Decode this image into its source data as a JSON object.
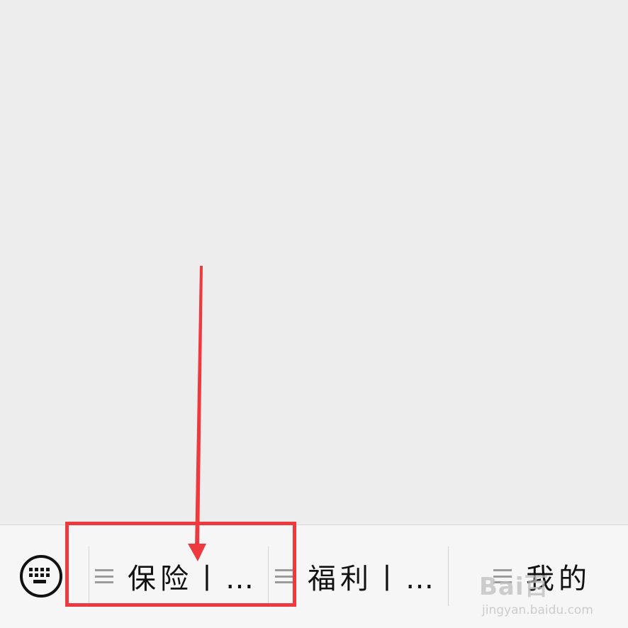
{
  "bottom_menu": {
    "items": [
      {
        "label": "保险丨…",
        "icon": "menu-lines-icon"
      },
      {
        "label": "福利丨…",
        "icon": "menu-lines-icon"
      },
      {
        "label": "我的",
        "icon": "menu-lines-icon"
      }
    ],
    "keyboard_icon": "keyboard-icon"
  },
  "annotation": {
    "color": "#ee3a3f"
  },
  "watermark": {
    "logo": "Bai百",
    "url": "jingyan.baidu.com"
  }
}
